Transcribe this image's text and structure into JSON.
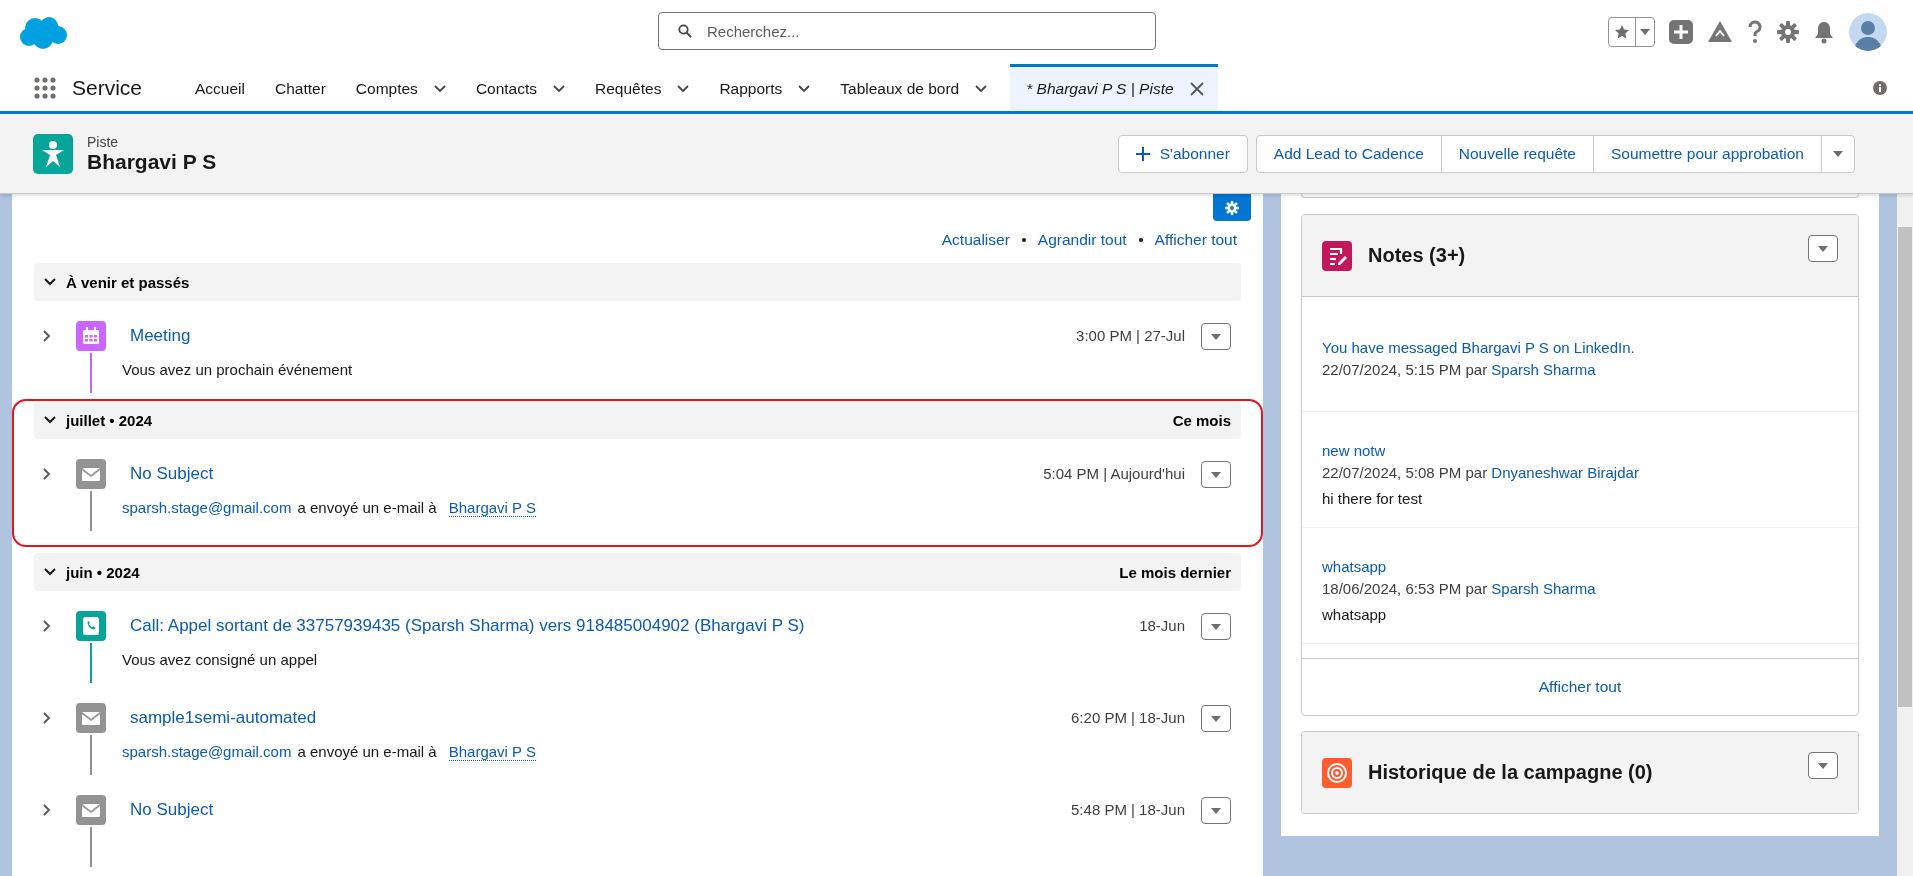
{
  "app": {
    "name": "Service",
    "search": {
      "placeholder": "Recherchez..."
    }
  },
  "nav_tabs": [
    {
      "label": "Accueil",
      "has_menu": false,
      "selected": false
    },
    {
      "label": "Chatter",
      "has_menu": false,
      "selected": false
    },
    {
      "label": "Comptes",
      "has_menu": true,
      "selected": false
    },
    {
      "label": "Contacts",
      "has_menu": true,
      "selected": false
    },
    {
      "label": "Requêtes",
      "has_menu": true,
      "selected": false
    },
    {
      "label": "Rapports",
      "has_menu": true,
      "selected": false
    },
    {
      "label": "Tableaux de bord",
      "has_menu": true,
      "selected": false
    },
    {
      "label": "* Bhargavi P S | Piste",
      "has_menu": false,
      "selected": true
    }
  ],
  "record": {
    "type": "Piste",
    "name": "Bhargavi P S",
    "actions": [
      {
        "label": "S'abonner",
        "kind": "follow"
      },
      {
        "label": "Add Lead to Cadence",
        "kind": "plain"
      },
      {
        "label": "Nouvelle requête",
        "kind": "plain"
      },
      {
        "label": "Soumettre pour approbation",
        "kind": "plain"
      }
    ]
  },
  "activity": {
    "links": [
      "Actualiser",
      "Agrandir tout",
      "Afficher tout"
    ],
    "sections": [
      {
        "title": "À venir et passés",
        "expanded": true,
        "highlighted": false,
        "items": [
          {
            "kind": "event",
            "title": "Meeting",
            "time": "3:00 PM | 27-Jul",
            "expanded": false,
            "description": "Vous avez un prochain événement"
          }
        ]
      },
      {
        "title": "juillet • 2024",
        "right_label": "Ce mois",
        "expanded": true,
        "highlighted": true,
        "items": [
          {
            "kind": "email",
            "title": "No Subject",
            "time": "5:04 PM | Aujourd'hui",
            "expanded": false,
            "sender": "sparsh.stage@gmail.com",
            "action": "a envoyé un e-mail à",
            "recipient": "Bhargavi P S"
          }
        ]
      },
      {
        "title": "juin • 2024",
        "right_label": "Le mois dernier",
        "expanded": true,
        "highlighted": false,
        "items": [
          {
            "kind": "call",
            "title": "Call: Appel sortant de 33757939435 (Sparsh Sharma) vers 918485004902 (Bhargavi P S)",
            "time": "18-Jun",
            "expanded": false,
            "description": "Vous avez consigné un appel"
          },
          {
            "kind": "email",
            "title": "sample1semi-automated",
            "time": "6:20 PM | 18-Jun",
            "expanded": false,
            "sender": "sparsh.stage@gmail.com",
            "action": "a envoyé un e-mail à",
            "recipient": "Bhargavi P S"
          },
          {
            "kind": "email",
            "title": "No Subject",
            "time": "5:48 PM | 18-Jun",
            "expanded": false
          }
        ]
      }
    ]
  },
  "notes": {
    "title": "Notes (3+)",
    "items": [
      {
        "title": "You have messaged Bhargavi P S on LinkedIn.",
        "date": "22/07/2024, 5:15 PM",
        "by": "par",
        "author": "Sparsh Sharma"
      },
      {
        "title": "new notw",
        "date": "22/07/2024, 5:08 PM",
        "by": "par",
        "author": "Dnyaneshwar Birajdar",
        "body": "hi there for test"
      },
      {
        "title": "whatsapp",
        "date": "18/06/2024, 6:53 PM",
        "by": "par",
        "author": "Sparsh Sharma",
        "body": "whatsapp"
      }
    ],
    "footer": "Afficher tout"
  },
  "campaign": {
    "title": "Historique de la campagne (0)"
  }
}
